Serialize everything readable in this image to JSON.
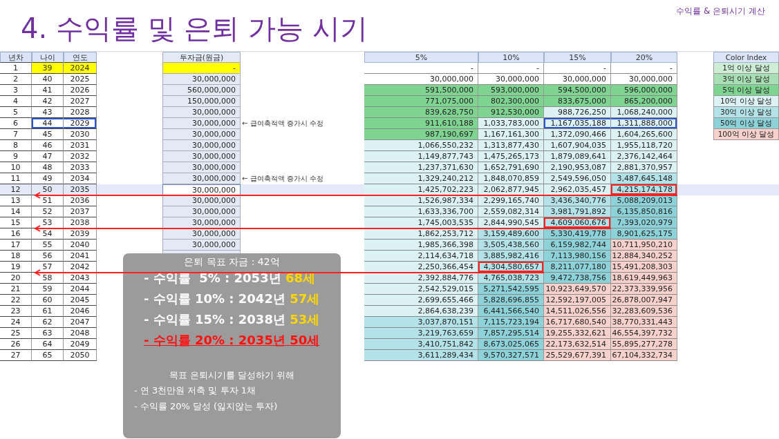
{
  "title": "4. 수익률 및 은퇴 가능 시기",
  "subtitle": "수익률 & 은퇴시기 계산",
  "table": {
    "left_columns": [
      "년차",
      "나이",
      "연도"
    ],
    "investment_column": "투자금(원금)",
    "rate_columns": [
      "5%",
      "10%",
      "15%",
      "20%"
    ],
    "rows": [
      {
        "number": "1",
        "age": "39",
        "year": "2024",
        "investment": "-",
        "highlighted": true,
        "selected": false,
        "arrow": false,
        "values": [
          {
            "value": "-",
            "color": "#ffffff"
          },
          {
            "value": "-",
            "color": "#ffffff"
          },
          {
            "value": "-",
            "color": "#ffffff"
          },
          {
            "value": "-",
            "color": "#ffffff"
          }
        ]
      },
      {
        "number": "2",
        "age": "40",
        "year": "2025",
        "investment": "30,000,000",
        "highlighted": false,
        "selected": false,
        "arrow": false,
        "values": [
          {
            "value": "30,000,000",
            "color": "#ffffff"
          },
          {
            "value": "30,000,000",
            "color": "#ffffff"
          },
          {
            "value": "30,000,000",
            "color": "#ffffff"
          },
          {
            "value": "30,000,000",
            "color": "#ffffff"
          }
        ]
      },
      {
        "number": "3",
        "age": "41",
        "year": "2026",
        "investment": "560,000,000",
        "highlighted": false,
        "selected": false,
        "arrow": false,
        "values": [
          {
            "value": "591,500,000",
            "color": "#7fd492"
          },
          {
            "value": "593,000,000",
            "color": "#7fd492"
          },
          {
            "value": "594,500,000",
            "color": "#7fd492"
          },
          {
            "value": "596,000,000",
            "color": "#7fd492"
          }
        ]
      },
      {
        "number": "4",
        "age": "42",
        "year": "2027",
        "investment": "150,000,000",
        "highlighted": false,
        "selected": false,
        "arrow": false,
        "values": [
          {
            "value": "771,075,000",
            "color": "#7fd492"
          },
          {
            "value": "802,300,000",
            "color": "#7fd492"
          },
          {
            "value": "833,675,000",
            "color": "#7fd492"
          },
          {
            "value": "865,200,000",
            "color": "#7fd492"
          }
        ]
      },
      {
        "number": "5",
        "age": "43",
        "year": "2028",
        "investment": "30,000,000",
        "highlighted": false,
        "selected": false,
        "arrow": false,
        "values": [
          {
            "value": "839,628,750",
            "color": "#7fd492"
          },
          {
            "value": "912,530,000",
            "color": "#7fd492"
          },
          {
            "value": "988,726,250",
            "color": "#ddf2f4"
          },
          {
            "value": "1,068,240,000",
            "color": "#ddf2f4"
          }
        ]
      },
      {
        "number": "6",
        "age": "44",
        "year": "2029",
        "investment": "30,000,000",
        "note": "← 급여축적액 증가시 수정",
        "age_box": {
          "color": "#2f55c8"
        },
        "highlighted": false,
        "selected": false,
        "arrow": false,
        "values": [
          {
            "value": "911,610,188",
            "color": "#7fd492"
          },
          {
            "value": "1,033,783,000",
            "color": "#ddf2f4"
          },
          {
            "value": "1,167,035,188",
            "color": "#ddf2f4",
            "box": {
              "color": "#2f55c8"
            }
          },
          {
            "value": "1,311,888,000",
            "color": "#ddf2f4",
            "box": {
              "color": "#2f55c8"
            }
          }
        ]
      },
      {
        "number": "7",
        "age": "45",
        "year": "2030",
        "investment": "30,000,000",
        "highlighted": false,
        "selected": false,
        "arrow": false,
        "values": [
          {
            "value": "987,190,697",
            "color": "#7fd492"
          },
          {
            "value": "1,167,161,300",
            "color": "#ddf2f4"
          },
          {
            "value": "1,372,090,466",
            "color": "#ddf2f4"
          },
          {
            "value": "1,604,265,600",
            "color": "#ddf2f4"
          }
        ]
      },
      {
        "number": "8",
        "age": "46",
        "year": "2031",
        "investment": "30,000,000",
        "highlighted": false,
        "selected": false,
        "arrow": false,
        "values": [
          {
            "value": "1,066,550,232",
            "color": "#ddf2f4"
          },
          {
            "value": "1,313,877,430",
            "color": "#ddf2f4"
          },
          {
            "value": "1,607,904,035",
            "color": "#ddf2f4"
          },
          {
            "value": "1,955,118,720",
            "color": "#ddf2f4"
          }
        ]
      },
      {
        "number": "9",
        "age": "47",
        "year": "2032",
        "investment": "30,000,000",
        "highlighted": false,
        "selected": false,
        "arrow": false,
        "values": [
          {
            "value": "1,149,877,743",
            "color": "#ddf2f4"
          },
          {
            "value": "1,475,265,173",
            "color": "#ddf2f4"
          },
          {
            "value": "1,879,089,641",
            "color": "#ddf2f4"
          },
          {
            "value": "2,376,142,464",
            "color": "#ddf2f4"
          }
        ]
      },
      {
        "number": "10",
        "age": "48",
        "year": "2033",
        "investment": "30,000,000",
        "highlighted": false,
        "selected": false,
        "arrow": false,
        "values": [
          {
            "value": "1,237,371,630",
            "color": "#ddf2f4"
          },
          {
            "value": "1,652,791,690",
            "color": "#ddf2f4"
          },
          {
            "value": "2,190,953,087",
            "color": "#ddf2f4"
          },
          {
            "value": "2,881,370,957",
            "color": "#ddf2f4"
          }
        ]
      },
      {
        "number": "11",
        "age": "49",
        "year": "2034",
        "investment": "30,000,000",
        "note": "← 급여축적액 증가시 수정",
        "highlighted": false,
        "selected": false,
        "arrow": false,
        "values": [
          {
            "value": "1,329,240,212",
            "color": "#ddf2f4"
          },
          {
            "value": "1,848,070,859",
            "color": "#ddf2f4"
          },
          {
            "value": "2,549,596,050",
            "color": "#ddf2f4"
          },
          {
            "value": "3,487,645,148",
            "color": "#b3e3e8"
          }
        ]
      },
      {
        "number": "12",
        "age": "50",
        "year": "2035",
        "investment": "30,000,000",
        "highlighted": false,
        "selected": true,
        "arrow": true,
        "values": [
          {
            "value": "1,425,702,223",
            "color": "#ddf2f4"
          },
          {
            "value": "2,062,877,945",
            "color": "#ddf2f4"
          },
          {
            "value": "2,962,035,457",
            "color": "#ddf2f4"
          },
          {
            "value": "4,215,174,178",
            "color": "#b3e3e8",
            "box": {
              "color": "#ff2020"
            }
          }
        ]
      },
      {
        "number": "13",
        "age": "51",
        "year": "2036",
        "investment": "30,000,000",
        "highlighted": false,
        "selected": false,
        "arrow": false,
        "values": [
          {
            "value": "1,526,987,334",
            "color": "#ddf2f4"
          },
          {
            "value": "2,299,165,740",
            "color": "#ddf2f4"
          },
          {
            "value": "3,436,340,776",
            "color": "#b3e3e8"
          },
          {
            "value": "5,088,209,013",
            "color": "#8ed2d9"
          }
        ]
      },
      {
        "number": "14",
        "age": "52",
        "year": "2037",
        "investment": "30,000,000",
        "highlighted": false,
        "selected": false,
        "arrow": false,
        "values": [
          {
            "value": "1,633,336,700",
            "color": "#ddf2f4"
          },
          {
            "value": "2,559,082,314",
            "color": "#ddf2f4"
          },
          {
            "value": "3,981,791,892",
            "color": "#b3e3e8"
          },
          {
            "value": "6,135,850,816",
            "color": "#8ed2d9"
          }
        ]
      },
      {
        "number": "15",
        "age": "53",
        "year": "2038",
        "investment": "30,000,000",
        "highlighted": false,
        "selected": false,
        "arrow": true,
        "values": [
          {
            "value": "1,745,003,535",
            "color": "#ddf2f4"
          },
          {
            "value": "2,844,990,545",
            "color": "#ddf2f4"
          },
          {
            "value": "4,609,060,676",
            "color": "#b3e3e8",
            "box": {
              "color": "#ff2020"
            }
          },
          {
            "value": "7,393,020,979",
            "color": "#8ed2d9"
          }
        ]
      },
      {
        "number": "16",
        "age": "54",
        "year": "2039",
        "investment": "30,000,000",
        "highlighted": false,
        "selected": false,
        "arrow": false,
        "values": [
          {
            "value": "1,862,253,712",
            "color": "#ddf2f4"
          },
          {
            "value": "3,159,489,600",
            "color": "#b3e3e8"
          },
          {
            "value": "5,330,419,778",
            "color": "#8ed2d9"
          },
          {
            "value": "8,901,625,175",
            "color": "#8ed2d9"
          }
        ]
      },
      {
        "number": "17",
        "age": "55",
        "year": "2040",
        "investment": "30,000,000",
        "highlighted": false,
        "selected": false,
        "arrow": false,
        "values": [
          {
            "value": "1,985,366,398",
            "color": "#ddf2f4"
          },
          {
            "value": "3,505,438,560",
            "color": "#b3e3e8"
          },
          {
            "value": "6,159,982,744",
            "color": "#8ed2d9"
          },
          {
            "value": "10,711,950,210",
            "color": "#f8d0cc"
          }
        ]
      },
      {
        "number": "18",
        "age": "56",
        "year": "2041",
        "highlighted": false,
        "selected": false,
        "arrow": false,
        "values": [
          {
            "value": "2,114,634,718",
            "color": "#ddf2f4"
          },
          {
            "value": "3,885,982,416",
            "color": "#b3e3e8"
          },
          {
            "value": "7,113,980,156",
            "color": "#8ed2d9"
          },
          {
            "value": "12,884,340,252",
            "color": "#f8d0cc"
          }
        ]
      },
      {
        "number": "19",
        "age": "57",
        "year": "2042",
        "highlighted": false,
        "selected": false,
        "arrow": true,
        "values": [
          {
            "value": "2,250,366,454",
            "color": "#ddf2f4"
          },
          {
            "value": "4,304,580,657",
            "color": "#b3e3e8",
            "box": {
              "color": "#ff2020"
            }
          },
          {
            "value": "8,211,077,180",
            "color": "#8ed2d9"
          },
          {
            "value": "15,491,208,303",
            "color": "#f8d0cc"
          }
        ]
      },
      {
        "number": "20",
        "age": "58",
        "year": "2043",
        "highlighted": false,
        "selected": false,
        "arrow": false,
        "values": [
          {
            "value": "2,392,884,776",
            "color": "#ddf2f4"
          },
          {
            "value": "4,765,038,723",
            "color": "#b3e3e8"
          },
          {
            "value": "9,472,738,756",
            "color": "#8ed2d9"
          },
          {
            "value": "18,619,449,963",
            "color": "#f8d0cc"
          }
        ]
      },
      {
        "number": "21",
        "age": "59",
        "year": "2044",
        "highlighted": false,
        "selected": false,
        "arrow": false,
        "values": [
          {
            "value": "2,542,529,015",
            "color": "#ddf2f4"
          },
          {
            "value": "5,271,542,595",
            "color": "#8ed2d9"
          },
          {
            "value": "10,923,649,570",
            "color": "#f8d0cc"
          },
          {
            "value": "22,373,339,956",
            "color": "#f8d0cc"
          }
        ]
      },
      {
        "number": "22",
        "age": "60",
        "year": "2045",
        "highlighted": false,
        "selected": false,
        "arrow": false,
        "values": [
          {
            "value": "2,699,655,466",
            "color": "#ddf2f4"
          },
          {
            "value": "5,828,696,855",
            "color": "#8ed2d9"
          },
          {
            "value": "12,592,197,005",
            "color": "#f8d0cc"
          },
          {
            "value": "26,878,007,947",
            "color": "#f8d0cc"
          }
        ]
      },
      {
        "number": "23",
        "age": "61",
        "year": "2046",
        "highlighted": false,
        "selected": false,
        "arrow": false,
        "values": [
          {
            "value": "2,864,638,239",
            "color": "#ddf2f4"
          },
          {
            "value": "6,441,566,540",
            "color": "#8ed2d9"
          },
          {
            "value": "14,511,026,556",
            "color": "#f8d0cc"
          },
          {
            "value": "32,283,609,536",
            "color": "#f8d0cc"
          }
        ]
      },
      {
        "number": "24",
        "age": "62",
        "year": "2047",
        "highlighted": false,
        "selected": false,
        "arrow": false,
        "values": [
          {
            "value": "3,037,870,151",
            "color": "#b3e3e8"
          },
          {
            "value": "7,115,723,194",
            "color": "#8ed2d9"
          },
          {
            "value": "16,717,680,540",
            "color": "#f8d0cc"
          },
          {
            "value": "38,770,331,443",
            "color": "#f8d0cc"
          }
        ]
      },
      {
        "number": "25",
        "age": "63",
        "year": "2048",
        "highlighted": false,
        "selected": false,
        "arrow": false,
        "values": [
          {
            "value": "3,219,763,659",
            "color": "#b3e3e8"
          },
          {
            "value": "7,857,295,514",
            "color": "#8ed2d9"
          },
          {
            "value": "19,255,332,621",
            "color": "#f8d0cc"
          },
          {
            "value": "46,554,397,732",
            "color": "#f8d0cc"
          }
        ]
      },
      {
        "number": "26",
        "age": "64",
        "year": "2049",
        "highlighted": false,
        "selected": false,
        "arrow": false,
        "values": [
          {
            "value": "3,410,751,842",
            "color": "#b3e3e8"
          },
          {
            "value": "8,673,025,065",
            "color": "#8ed2d9"
          },
          {
            "value": "22,173,632,514",
            "color": "#f8d0cc"
          },
          {
            "value": "55,895,277,278",
            "color": "#f8d0cc"
          }
        ]
      },
      {
        "number": "27",
        "age": "65",
        "year": "2050",
        "highlighted": false,
        "selected": false,
        "arrow": false,
        "values": [
          {
            "value": "3,611,289,434",
            "color": "#b3e3e8"
          },
          {
            "value": "9,570,327,571",
            "color": "#8ed2d9"
          },
          {
            "value": "25,529,677,391",
            "color": "#f8d0cc"
          },
          {
            "value": "67,104,332,734",
            "color": "#f8d0cc"
          }
        ]
      }
    ]
  },
  "color_index": {
    "title": "Color Index",
    "items": [
      {
        "label": "1억 이상 달성",
        "color": "#cdeed5"
      },
      {
        "label": "3억 이상 달성",
        "color": "#a9dfb5"
      },
      {
        "label": "5억 이상 달성",
        "color": "#7fd492"
      },
      {
        "label": "10억 이상 달성",
        "color": "#ddf2f4"
      },
      {
        "label": "30억 이상 달성",
        "color": "#b3e3e8"
      },
      {
        "label": "50억 이상 달성",
        "color": "#8ed2d9"
      },
      {
        "label": "100억 이상 달성",
        "color": "#f8d0cc"
      }
    ]
  },
  "summary": {
    "title": "은퇴 목표 자금 : 42억",
    "results": [
      {
        "text": "- 수익률  5% : 2053년",
        "age": "68세",
        "highlighted": false
      },
      {
        "text": "- 수익률 10% : 2042년",
        "age": "57세",
        "highlighted": false
      },
      {
        "text": "- 수익률 15% : 2038년",
        "age": "53세",
        "highlighted": false
      },
      {
        "text": "- 수익률 20% : 2035년",
        "age": "50세",
        "highlighted": true
      }
    ],
    "plan_title": "목표 은퇴시기를 달성하기 위해",
    "plan_items": [
      "- 연 3천만원 저축 및 투자 1채",
      "- 수익률 20% 달성 (잃지않는 투자)"
    ]
  }
}
